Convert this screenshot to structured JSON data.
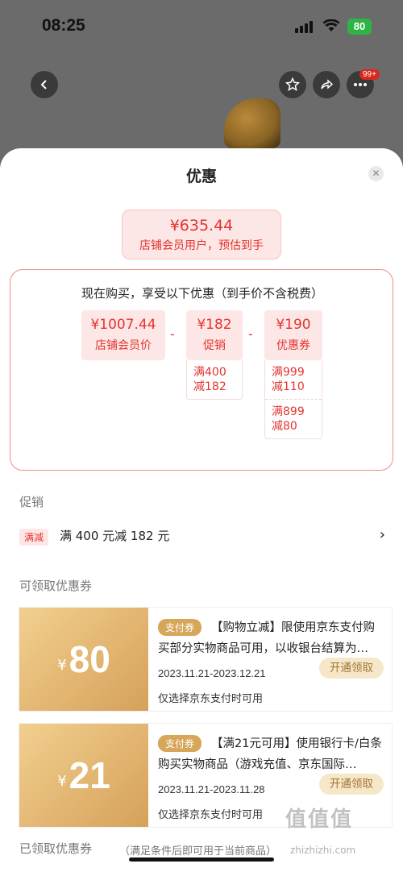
{
  "status_bar": {
    "time": "08:25",
    "battery": "80"
  },
  "top_nav": {
    "more_badge": "99+"
  },
  "sheet": {
    "title": "优惠",
    "final": {
      "price": "¥635.44",
      "label": "店铺会员用户，预估到手"
    },
    "calc": {
      "caption": "现在购买，享受以下优惠（到手价不含税费）",
      "member": {
        "price": "¥1007.44",
        "label": "店铺会员价"
      },
      "operator": "-",
      "promo": {
        "price": "¥182",
        "label": "促销",
        "rules": [
          "满400\n减182"
        ]
      },
      "coupon": {
        "price": "¥190",
        "label": "优惠券",
        "rules": [
          "满999\n减110",
          "满899\n减80"
        ]
      }
    },
    "promo_section": {
      "label": "促销",
      "tag": "满减",
      "text": "满 400 元减 182 元"
    },
    "coupon_section": {
      "label": "可领取优惠券",
      "coupons": [
        {
          "amount": "80",
          "type": "支付券",
          "desc": "【购物立减】限使用京东支付购买部分实物商品可用，以收银台结算为…",
          "date": "2023.11.21-2023.12.21",
          "button": "开通领取",
          "note": "仅选择京东支付时可用"
        },
        {
          "amount": "21",
          "type": "支付券",
          "desc": "【满21元可用】使用银行卡/白条购买实物商品（游戏充值、京东国际…",
          "date": "2023.11.21-2023.11.28",
          "button": "开通领取",
          "note": "仅选择京东支付时可用"
        }
      ]
    },
    "claimed_section": {
      "label": "已领取优惠券",
      "sub": "（满足条件后即可用于当前商品）"
    }
  },
  "watermark": {
    "big": "值值值",
    "small": "zhizhizhi.com"
  },
  "colors": {
    "accent": "#e3342f",
    "coupon_gold": "#d5a15a",
    "pink_bg": "#fde6e6"
  }
}
